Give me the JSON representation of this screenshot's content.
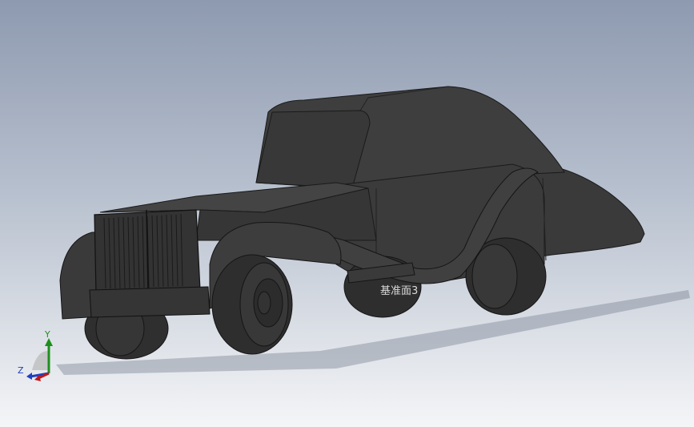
{
  "viewport": {
    "background_top": "#8e9ab0",
    "background_bottom": "#f4f5f7"
  },
  "model": {
    "body_color": "#3a3a3a",
    "plane_label": "基准面3"
  },
  "triad": {
    "y_label": "Y",
    "z_label": "Z",
    "x_color": "#c01818",
    "y_color": "#1e8f1e",
    "z_color": "#2040c0"
  }
}
